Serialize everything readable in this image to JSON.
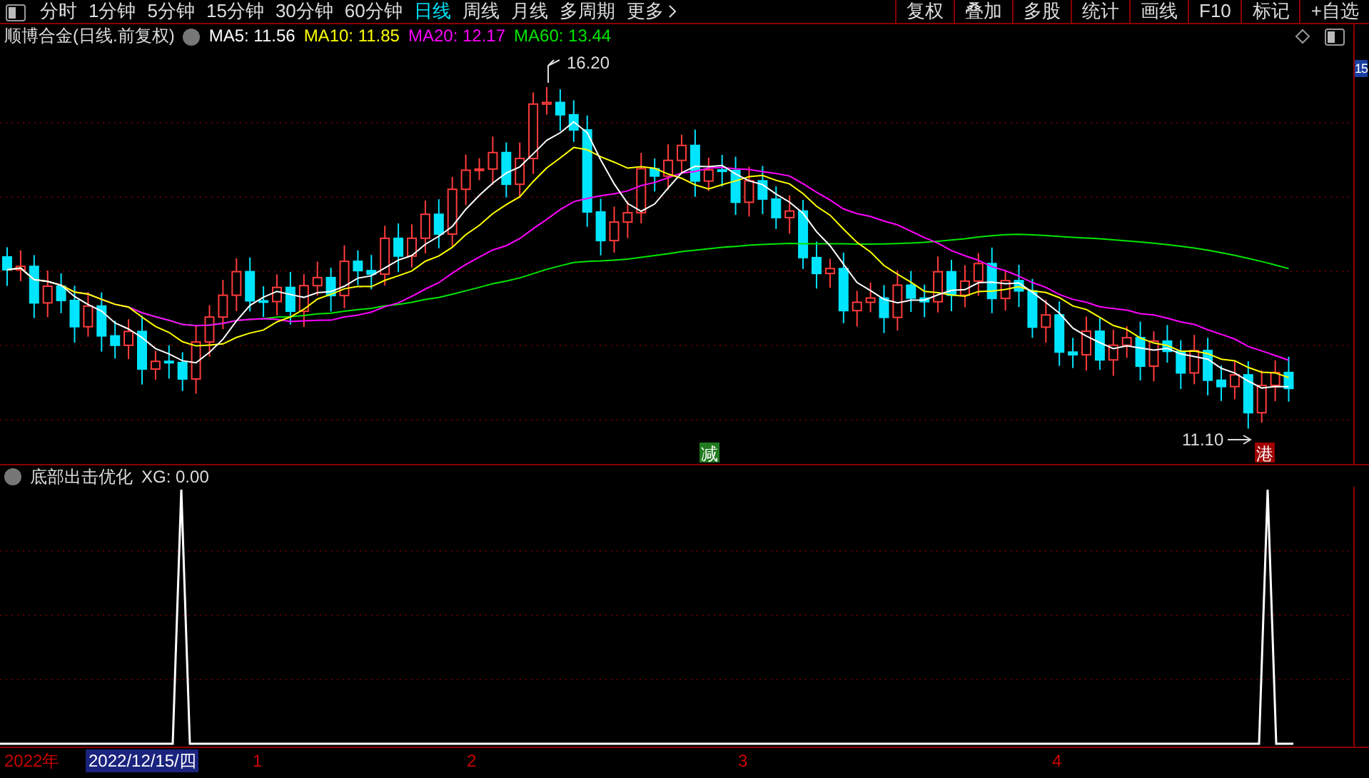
{
  "toolbar": {
    "tabs": [
      {
        "label": "分时",
        "selected": false
      },
      {
        "label": "1分钟",
        "selected": false
      },
      {
        "label": "5分钟",
        "selected": false
      },
      {
        "label": "15分钟",
        "selected": false
      },
      {
        "label": "30分钟",
        "selected": false
      },
      {
        "label": "60分钟",
        "selected": false
      },
      {
        "label": "日线",
        "selected": true
      },
      {
        "label": "周线",
        "selected": false
      },
      {
        "label": "月线",
        "selected": false
      },
      {
        "label": "多周期",
        "selected": false
      }
    ],
    "more": "更多",
    "right_buttons": [
      "复权",
      "叠加",
      "多股",
      "统计",
      "画线",
      "F10",
      "标记",
      "+自选"
    ]
  },
  "main_chart": {
    "stock_name": "顺博合金(日线.前复权)",
    "ma_legend": [
      {
        "label": "MA5: 11.56",
        "color": "#ffffff"
      },
      {
        "label": "MA10: 11.85",
        "color": "#ffff00"
      },
      {
        "label": "MA20: 12.17",
        "color": "#ff00ff"
      },
      {
        "label": "MA60: 13.44",
        "color": "#00e600"
      }
    ],
    "high_label": "16.20",
    "low_label": "11.10",
    "signals": [
      {
        "text": "减",
        "color": "#1f7a1f"
      },
      {
        "text": "港",
        "color": "#a00000"
      }
    ],
    "price_axis_label": "15"
  },
  "indicator": {
    "name": "底部出击优化",
    "value": "XG: 0.00"
  },
  "time_axis": {
    "year": "2022年",
    "cursor_date": "2022/12/15/四",
    "months": [
      "1",
      "2",
      "3",
      "4"
    ]
  }
}
